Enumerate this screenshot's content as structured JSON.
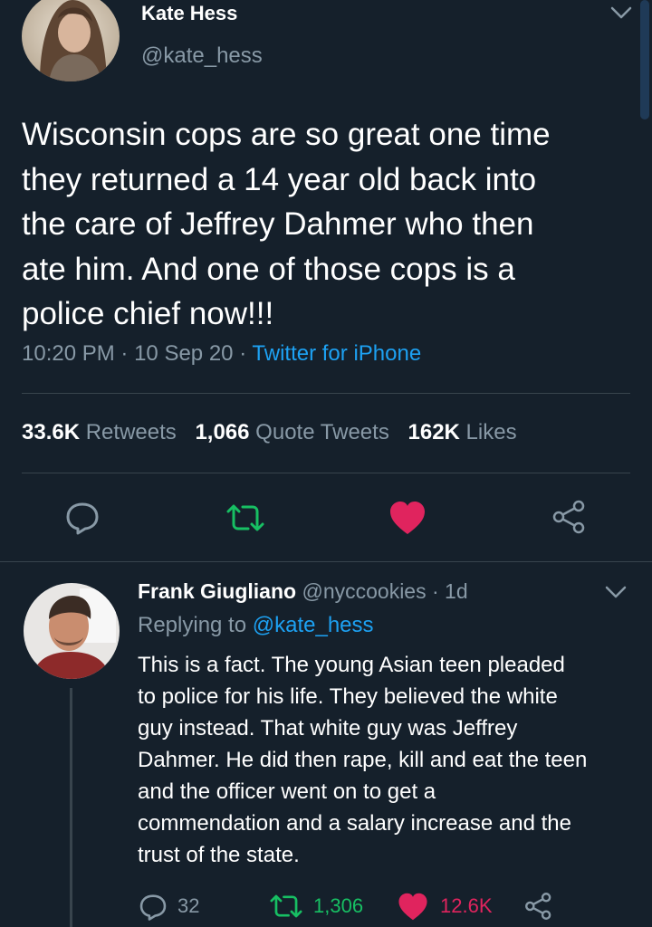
{
  "tweet": {
    "author_name": "Kate Hess",
    "author_handle": "@kate_hess",
    "text_lines": [
      "Wisconsin cops are so great one time",
      "they returned a 14 year old back into",
      "the care of Jeffrey Dahmer who then",
      "ate him. And one of those cops is a",
      "police chief now!!!"
    ],
    "time": "10:20 PM",
    "date": "10 Sep 20",
    "client": "Twitter for iPhone",
    "separator": "·",
    "stats": {
      "retweets_count": "33.6K",
      "retweets_label": "Retweets",
      "quotes_count": "1,066",
      "quotes_label": "Quote Tweets",
      "likes_count": "162K",
      "likes_label": "Likes"
    }
  },
  "reply": {
    "author_name": "Frank Giugliano",
    "author_handle": "@nyccookies",
    "age": "1d",
    "separator": "·",
    "replying_prefix": "Replying to",
    "replying_handle": "@kate_hess",
    "text_lines": [
      "This is a fact. The young Asian teen pleaded",
      "to police for his life. They believed the white",
      "guy instead. That white guy was Jeffrey",
      "Dahmer. He did then rape, kill and eat the teen",
      "and the officer went on to get a",
      "commendation and a salary increase and the",
      "trust of the state."
    ],
    "counts": {
      "replies": "32",
      "retweets": "1,306",
      "likes": "12.6K"
    }
  },
  "colors": {
    "background": "#15202b",
    "muted": "#8899a6",
    "link": "#1da1f2",
    "retweet_green": "#17bf63",
    "like_red": "#e0245e"
  },
  "icons": [
    "chevron-down-icon",
    "reply-icon",
    "retweet-icon",
    "like-icon",
    "share-icon"
  ]
}
